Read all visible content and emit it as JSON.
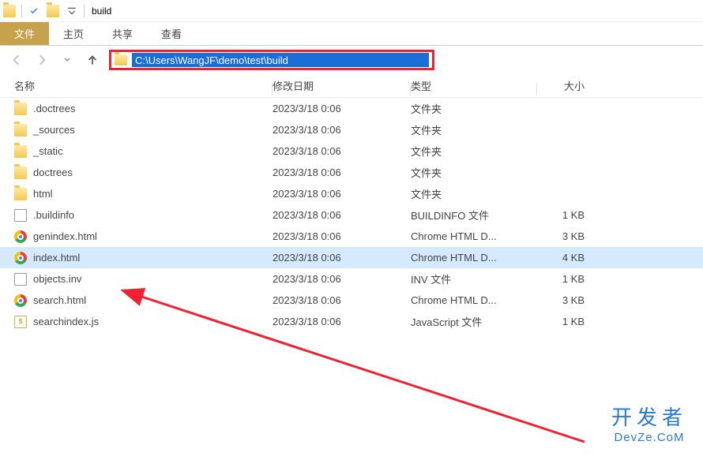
{
  "window": {
    "title": "build"
  },
  "ribbon": {
    "file": "文件",
    "home": "主页",
    "share": "共享",
    "view": "查看"
  },
  "address": {
    "path": "C:\\Users\\WangJF\\demo\\test\\build"
  },
  "columns": {
    "name": "名称",
    "date": "修改日期",
    "type": "类型",
    "size": "大小"
  },
  "size_unit": "KB",
  "files": [
    {
      "icon": "folder",
      "name": ".doctrees",
      "date": "2023/3/18 0:06",
      "type": "文件夹",
      "size": ""
    },
    {
      "icon": "folder",
      "name": "_sources",
      "date": "2023/3/18 0:06",
      "type": "文件夹",
      "size": ""
    },
    {
      "icon": "folder",
      "name": "_static",
      "date": "2023/3/18 0:06",
      "type": "文件夹",
      "size": ""
    },
    {
      "icon": "folder",
      "name": "doctrees",
      "date": "2023/3/18 0:06",
      "type": "文件夹",
      "size": ""
    },
    {
      "icon": "folder",
      "name": "html",
      "date": "2023/3/18 0:06",
      "type": "文件夹",
      "size": ""
    },
    {
      "icon": "file",
      "name": ".buildinfo",
      "date": "2023/3/18 0:06",
      "type": "BUILDINFO 文件",
      "size": "1 KB"
    },
    {
      "icon": "chrome",
      "name": "genindex.html",
      "date": "2023/3/18 0:06",
      "type": "Chrome HTML D...",
      "size": "3 KB"
    },
    {
      "icon": "chrome",
      "name": "index.html",
      "date": "2023/3/18 0:06",
      "type": "Chrome HTML D...",
      "size": "4 KB",
      "selected": true
    },
    {
      "icon": "file",
      "name": "objects.inv",
      "date": "2023/3/18 0:06",
      "type": "INV 文件",
      "size": "1 KB"
    },
    {
      "icon": "chrome",
      "name": "search.html",
      "date": "2023/3/18 0:06",
      "type": "Chrome HTML D...",
      "size": "3 KB"
    },
    {
      "icon": "js",
      "name": "searchindex.js",
      "date": "2023/3/18 0:06",
      "type": "JavaScript 文件",
      "size": "1 KB"
    }
  ],
  "watermark": {
    "line1": "开发者",
    "line2": "DevZe.CoM"
  }
}
